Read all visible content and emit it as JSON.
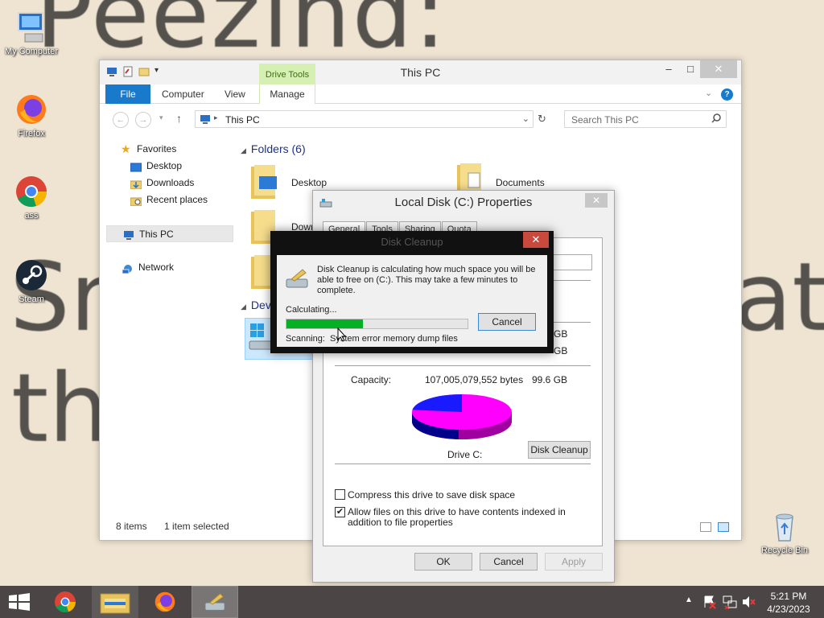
{
  "wallpaper": {
    "line1": "Peezind:",
    "line2": "Sn",
    "line3": "at",
    "line4": "the"
  },
  "desktop_icons": [
    {
      "name": "my-computer",
      "label": "My Computer"
    },
    {
      "name": "firefox",
      "label": "Firefox"
    },
    {
      "name": "chrome",
      "label": "ass"
    },
    {
      "name": "steam",
      "label": "Steam"
    },
    {
      "name": "recycle-bin",
      "label": "Recycle Bin"
    }
  ],
  "explorer": {
    "title": "This PC",
    "contextual_tab": "Drive Tools",
    "tabs": {
      "file": "File",
      "computer": "Computer",
      "view": "View",
      "manage": "Manage"
    },
    "address": "This PC",
    "search_placeholder": "Search This PC",
    "nav": {
      "favorites": "Favorites",
      "desktop": "Desktop",
      "downloads": "Downloads",
      "recent": "Recent places",
      "this_pc": "This PC",
      "network": "Network"
    },
    "groups": {
      "folders": "Folders (6)",
      "devices": "Dev"
    },
    "folders": {
      "desktop": "Desktop",
      "documents": "Documents",
      "downloads": "Dowr"
    },
    "status": {
      "items": "8 items",
      "selected": "1 item selected"
    }
  },
  "properties": {
    "title": "Local Disk (C:) Properties",
    "tabs": [
      "General",
      "Tools",
      "Sharing",
      "Quota"
    ],
    "used_suffix": "GB",
    "free_suffix": "GB",
    "capacity_label": "Capacity:",
    "capacity_bytes": "107,005,079,552 bytes",
    "capacity_gb": "99.6 GB",
    "drive_label": "Drive C:",
    "disk_cleanup_button": "Disk Cleanup",
    "compress_label": "Compress this drive to save disk space",
    "compress_checked": false,
    "index_label": "Allow files on this drive to have contents indexed in addition to file properties",
    "index_checked": true,
    "ok": "OK",
    "cancel": "Cancel",
    "apply": "Apply",
    "colors": {
      "used": "#1a1aff",
      "free": "#ff00ff"
    },
    "used_fraction": 0.23
  },
  "cleanup": {
    "title": "Disk Cleanup",
    "message": "Disk Cleanup is calculating how much space you will be able to free on  (C:). This may take a few minutes to complete.",
    "status": "Calculating...",
    "progress_fraction": 0.42,
    "cancel": "Cancel",
    "scanning_label": "Scanning:",
    "scanning_item": "System error memory dump files"
  },
  "taskbar": {
    "time": "5:21 PM",
    "date": "4/23/2023",
    "items": [
      "start",
      "chrome",
      "file-explorer",
      "firefox",
      "disk-cleanup"
    ]
  },
  "colors": {
    "accent": "#1979ca",
    "progress": "#06b025",
    "taskbar": "#4b4545"
  }
}
